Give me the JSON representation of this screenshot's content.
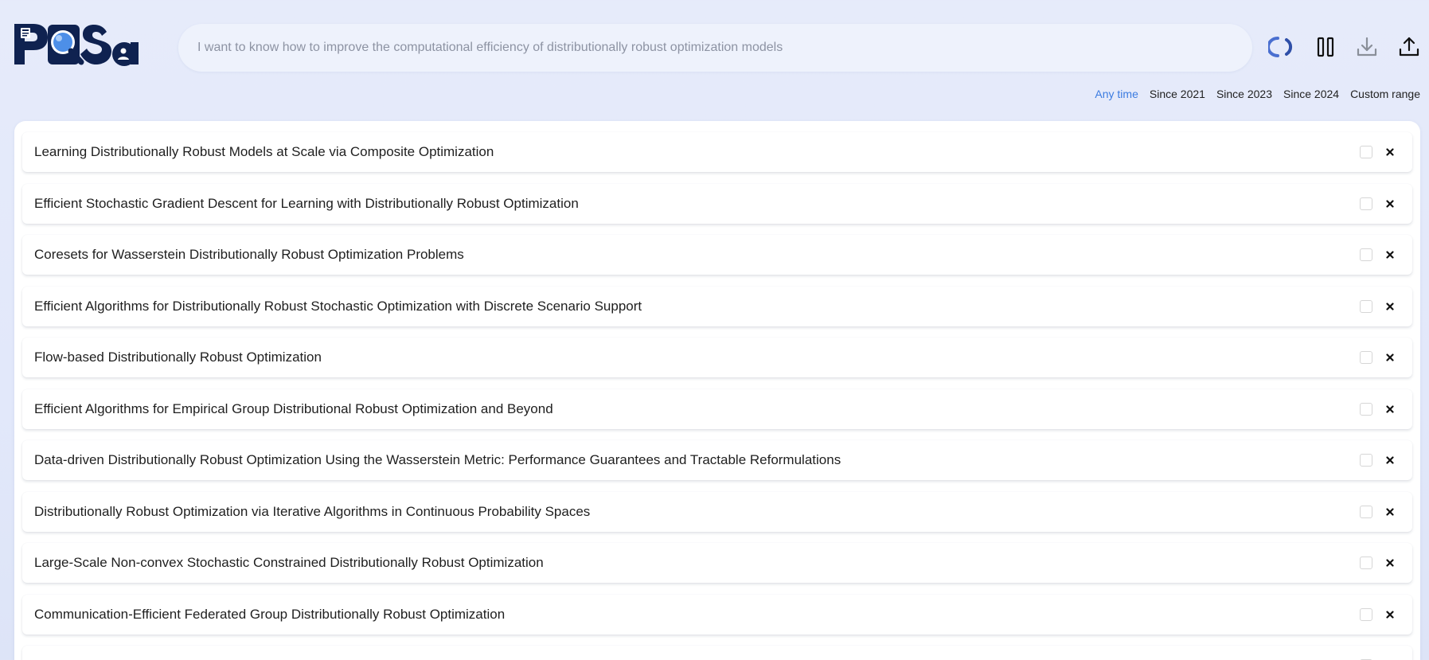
{
  "app": {
    "logo_text": "PQSa",
    "accent_color": "#3b7be0",
    "logo_color": "#0f2250"
  },
  "search": {
    "placeholder": "I want to know how to improve the computational efficiency of distributionally robust optimization models"
  },
  "toolbar": {
    "icons": [
      "loading-spinner-icon",
      "pause-icon",
      "download-icon",
      "upload-share-icon"
    ]
  },
  "time_filters": {
    "options": [
      "Any time",
      "Since 2021",
      "Since 2023",
      "Since 2024",
      "Custom range"
    ],
    "selected": "Any time"
  },
  "results": [
    {
      "title": "Learning Distributionally Robust Models at Scale via Composite Optimization",
      "checked": false
    },
    {
      "title": "Efficient Stochastic Gradient Descent for Learning with Distributionally Robust Optimization",
      "checked": false
    },
    {
      "title": "Coresets for Wasserstein Distributionally Robust Optimization Problems",
      "checked": false
    },
    {
      "title": "Efficient Algorithms for Distributionally Robust Stochastic Optimization with Discrete Scenario Support",
      "checked": false
    },
    {
      "title": "Flow-based Distributionally Robust Optimization",
      "checked": false
    },
    {
      "title": "Efficient Algorithms for Empirical Group Distributional Robust Optimization and Beyond",
      "checked": false
    },
    {
      "title": "Data-driven Distributionally Robust Optimization Using the Wasserstein Metric: Performance Guarantees and Tractable Reformulations",
      "checked": false
    },
    {
      "title": "Distributionally Robust Optimization via Iterative Algorithms in Continuous Probability Spaces",
      "checked": false
    },
    {
      "title": "Large-Scale Non-convex Stochastic Constrained Distributionally Robust Optimization",
      "checked": false
    },
    {
      "title": "Communication-Efficient Federated Group Distributionally Robust Optimization",
      "checked": false
    },
    {
      "title": "",
      "checked": false
    }
  ]
}
